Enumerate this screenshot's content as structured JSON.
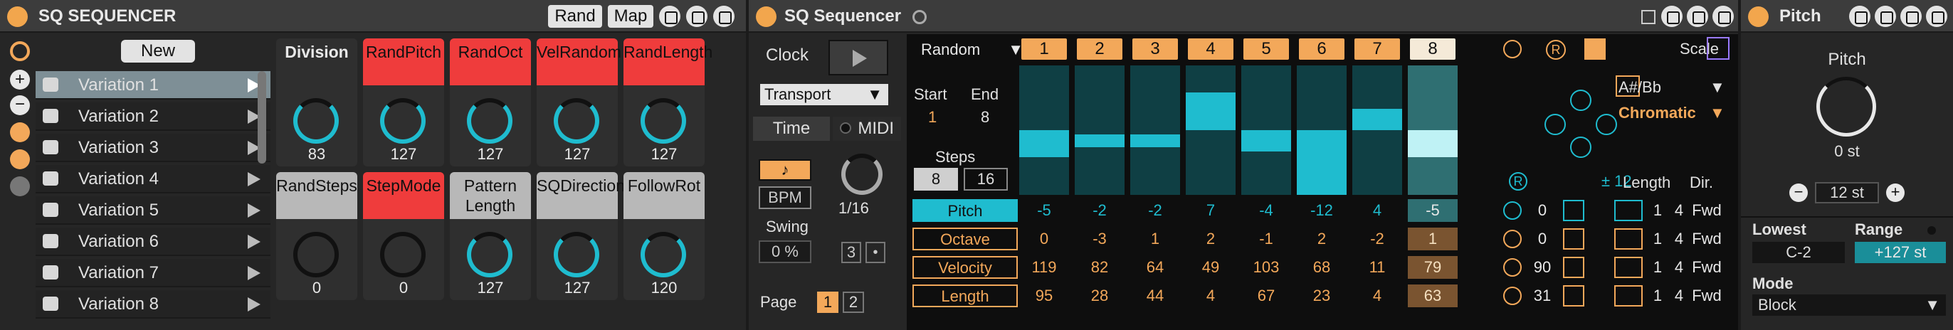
{
  "device1": {
    "title": "SQ SEQUENCER",
    "rand": "Rand",
    "map": "Map",
    "new": "New",
    "variations": [
      "Variation 1",
      "Variation 2",
      "Variation 3",
      "Variation 4",
      "Variation 5",
      "Variation 6",
      "Variation 7",
      "Variation 8"
    ],
    "knobs_top": [
      {
        "label": "Division",
        "value": "83",
        "style": "dark"
      },
      {
        "label": "RandPitch",
        "value": "127",
        "style": "red"
      },
      {
        "label": "RandOct",
        "value": "127",
        "style": "red"
      },
      {
        "label": "VelRandom",
        "value": "127",
        "style": "red"
      },
      {
        "label": "RandLength",
        "value": "127",
        "style": "red"
      }
    ],
    "knobs_bottom": [
      {
        "label": "RandSteps",
        "value": "0",
        "style": "grey"
      },
      {
        "label": "StepMode",
        "value": "0",
        "style": "red"
      },
      {
        "label": "Pattern Length",
        "value": "127",
        "style": "grey"
      },
      {
        "label": "SQDirection",
        "value": "127",
        "style": "grey"
      },
      {
        "label": "FollowRot",
        "value": "120",
        "style": "grey"
      }
    ]
  },
  "device2": {
    "title": "SQ Sequencer",
    "clock": "Clock",
    "transport": "Transport",
    "time": "Time",
    "midi": "MIDI",
    "bpm": "BPM",
    "rate": "1/16",
    "swing": "Swing",
    "swing_value": "0 %",
    "triplet": "3",
    "dot": "•",
    "page": "Page",
    "pages": [
      "1",
      "2"
    ],
    "mode": "Random",
    "start": "Start",
    "start_value": "1",
    "end": "End",
    "end_value": "8",
    "steps": "Steps",
    "steps_value": "8",
    "steps_max": "16",
    "step_numbers": [
      "1",
      "2",
      "3",
      "4",
      "5",
      "6",
      "7",
      "8"
    ],
    "pitch_bars": [
      -5,
      -2,
      -2,
      7,
      -4,
      -12,
      4,
      -5
    ],
    "rows": [
      {
        "label": "Pitch",
        "values": [
          "-5",
          "-2",
          "-2",
          "7",
          "-4",
          "-12",
          "4",
          "-5"
        ],
        "offset": "0",
        "length": [
          "1",
          "4"
        ],
        "dir": "Fwd"
      },
      {
        "label": "Octave",
        "values": [
          "0",
          "-3",
          "1",
          "2",
          "-1",
          "2",
          "-2",
          "1"
        ],
        "offset": "0",
        "length": [
          "1",
          "4"
        ],
        "dir": "Fwd"
      },
      {
        "label": "Velocity",
        "values": [
          "119",
          "82",
          "64",
          "49",
          "103",
          "68",
          "11",
          "79"
        ],
        "offset": "90",
        "length": [
          "1",
          "4"
        ],
        "dir": "Fwd"
      },
      {
        "label": "Length",
        "values": [
          "95",
          "28",
          "44",
          "4",
          "67",
          "23",
          "4",
          "63"
        ],
        "offset": "31",
        "length": [
          "1",
          "4"
        ],
        "dir": "Fwd"
      }
    ],
    "r_label": "R",
    "range": "± 12",
    "scale": "Scale",
    "scale_root": "A#/Bb",
    "scale_name": "Chromatic",
    "length_header": "Length",
    "dir_header": "Dir."
  },
  "device3": {
    "title": "Pitch",
    "pitch_label": "Pitch",
    "pitch_value": "0 st",
    "step_value": "12 st",
    "lowest": "Lowest",
    "lowest_value": "C-2",
    "range": "Range",
    "range_value": "+127 st",
    "mode": "Mode",
    "mode_value": "Block"
  },
  "colors": {
    "accent": "#f3a85a",
    "teal": "#1fbccf",
    "red": "#ef3c3c",
    "panel": "#262626"
  }
}
